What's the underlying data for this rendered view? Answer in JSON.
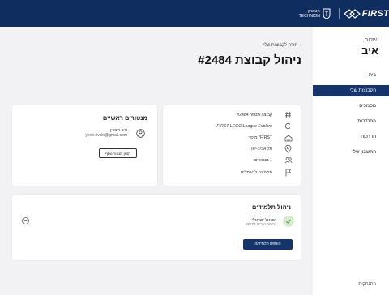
{
  "colors": {
    "topbar": "#0f2d5f",
    "accent": "#16346c",
    "success_bg": "#d8ecd0",
    "success": "#4a9b3a"
  },
  "header": {
    "technion_text": "הטכניון TECHNION",
    "first_logo_text": "FIRST"
  },
  "sidebar": {
    "greeting": "שלום,",
    "user_name": "איב",
    "items": [
      {
        "label": "בית",
        "active": false,
        "icon": "home"
      },
      {
        "label": "הקבוצות שלי",
        "active": true,
        "icon": "teams"
      },
      {
        "label": "מסמכים",
        "active": false,
        "icon": "documents"
      },
      {
        "label": "התנדבות",
        "active": false,
        "icon": "volunteer"
      },
      {
        "label": "הדרכות",
        "active": false,
        "icon": "training"
      },
      {
        "label": "החשבון שלי",
        "active": false,
        "icon": "account"
      }
    ],
    "logout": "התנתקות"
  },
  "breadcrumb": {
    "back_icon": "chevron-right",
    "label": "חזרה לקבוצות שלי"
  },
  "page": {
    "title": "ניהול קבוצת #2484"
  },
  "team_info": {
    "rows": [
      {
        "icon": "hash",
        "text": "קבוצה מספר #2484"
      },
      {
        "icon": "league",
        "text": "FIRST LEGO League Explore"
      },
      {
        "icon": "school",
        "text": "FIRST* מוסד"
      },
      {
        "icon": "location",
        "text": "תל אביב-יפו"
      },
      {
        "icon": "people",
        "text": "1 מנטורים"
      },
      {
        "icon": "flag",
        "text": "ממתינה לרשמלים"
      }
    ]
  },
  "mentors": {
    "heading": "מנטורים ראשיים",
    "name": "איב ריבקין",
    "email": "yeve.rivkin@gmail.com",
    "invite_button": "הזמן מנטור נוסף"
  },
  "students": {
    "heading": "ניהול תלמידים",
    "items": [
      {
        "name": "ישראל ישראלי",
        "status": "אישור הורים נחתם"
      }
    ],
    "add_button": "הוספת תלמיד/ה"
  }
}
